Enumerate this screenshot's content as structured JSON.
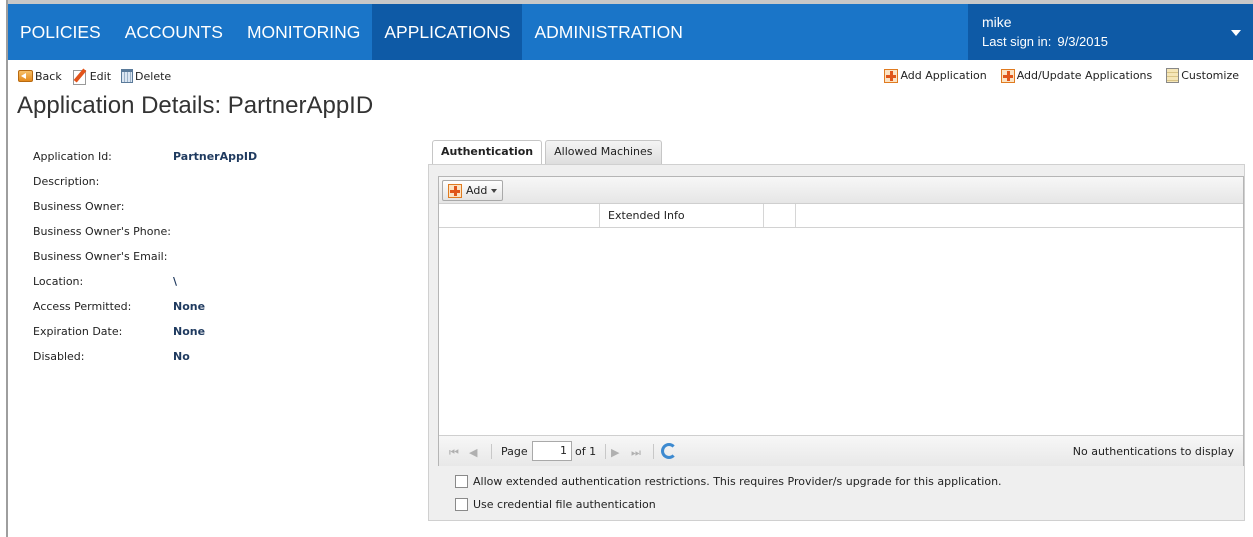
{
  "nav": {
    "items": [
      {
        "label": "POLICIES"
      },
      {
        "label": "ACCOUNTS"
      },
      {
        "label": "MONITORING"
      },
      {
        "label": "APPLICATIONS"
      },
      {
        "label": "ADMINISTRATION"
      }
    ],
    "active": "APPLICATIONS"
  },
  "user": {
    "name": "mike",
    "last_signin_label": "Last sign in:",
    "last_signin_date": "9/3/2015"
  },
  "toolbar": {
    "back": "Back",
    "edit": "Edit",
    "delete": "Delete",
    "add_application": "Add Application",
    "add_update_applications": "Add/Update Applications",
    "customize": "Customize"
  },
  "page": {
    "title": "Application Details: PartnerAppID"
  },
  "details": [
    {
      "label": "Application Id:",
      "value": "PartnerAppID"
    },
    {
      "label": "Description:",
      "value": ""
    },
    {
      "label": "Business Owner:",
      "value": ""
    },
    {
      "label": "Business Owner's Phone:",
      "value": ""
    },
    {
      "label": "Business Owner's Email:",
      "value": ""
    },
    {
      "label": "Location:",
      "value": "\\"
    },
    {
      "label": "Access Permitted:",
      "value": "None"
    },
    {
      "label": "Expiration Date:",
      "value": "None"
    },
    {
      "label": "Disabled:",
      "value": "No"
    }
  ],
  "tabs": [
    {
      "label": "Authentication",
      "active": true
    },
    {
      "label": "Allowed Machines",
      "active": false
    }
  ],
  "grid": {
    "add_label": "Add",
    "columns": [
      "",
      "Extended Info",
      ""
    ],
    "rows": []
  },
  "pager": {
    "page_label": "Page",
    "current_page": "1",
    "of_label": "of 1",
    "empty_text": "No authentications to display"
  },
  "options": {
    "extended_restrictions": "Allow extended authentication restrictions. This requires Provider/s upgrade for this application.",
    "credential_file": "Use credential file authentication"
  },
  "colors": {
    "nav_bg": "#1a75c8",
    "nav_active_bg": "#0e5aa6",
    "value_text": "#1f3a5f"
  }
}
